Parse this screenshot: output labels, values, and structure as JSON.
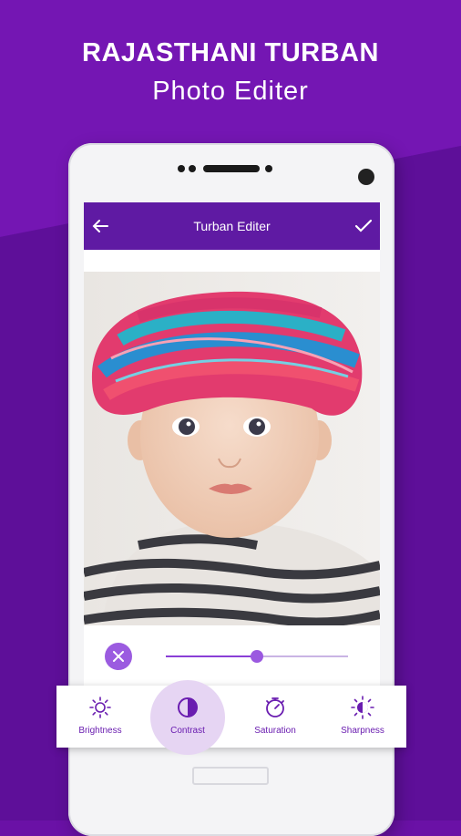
{
  "promo": {
    "title": "RAJASTHANI TURBAN",
    "subtitle": "Photo Editer"
  },
  "appbar": {
    "title": "Turban Editer",
    "back_icon": "arrow-left-icon",
    "confirm_icon": "check-icon"
  },
  "slider": {
    "value_fraction": 0.5,
    "cancel_icon": "close-icon"
  },
  "tools": [
    {
      "label": "Brightness",
      "icon": "brightness-icon",
      "active": false
    },
    {
      "label": "Contrast",
      "icon": "contrast-icon",
      "active": true
    },
    {
      "label": "Saturation",
      "icon": "saturation-icon",
      "active": false
    },
    {
      "label": "Sharpness",
      "icon": "sharpness-icon",
      "active": false
    }
  ],
  "colors": {
    "background": "#6a11a6",
    "appbar": "#5f1aa3",
    "accent": "#9b5be0",
    "tool_text": "#6a1db0"
  }
}
